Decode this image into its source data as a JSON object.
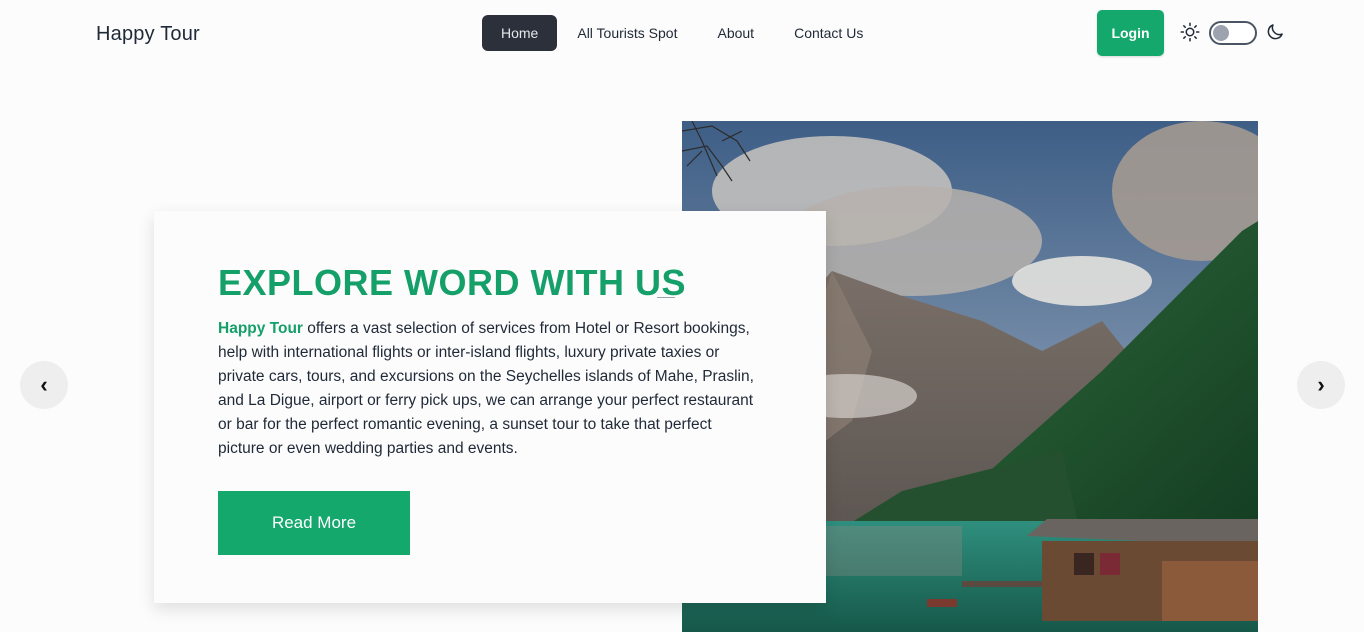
{
  "navbar": {
    "brand": "Happy Tour",
    "links": [
      "Home",
      "All Tourists Spot",
      "About",
      "Contact Us"
    ],
    "login_label": "Login"
  },
  "hero": {
    "title": "EXPLORE WORD WITH US",
    "highlight": "Happy Tour",
    "description": " offers a vast selection of services from Hotel or Resort bookings, help with international flights or inter-island flights, luxury private taxies or private cars, tours, and excursions on the Seychelles islands of Mahe, Praslin, and La Digue, airport or ferry pick ups, we can arrange your perfect restaurant or bar for the perfect romantic evening, a sunset tour to take that perfect picture or even wedding parties and events.",
    "button_label": "Read More"
  },
  "carousel": {
    "prev": "‹",
    "next": "›"
  },
  "colors": {
    "accent": "#14a86c",
    "active_nav": "#2b303b"
  }
}
